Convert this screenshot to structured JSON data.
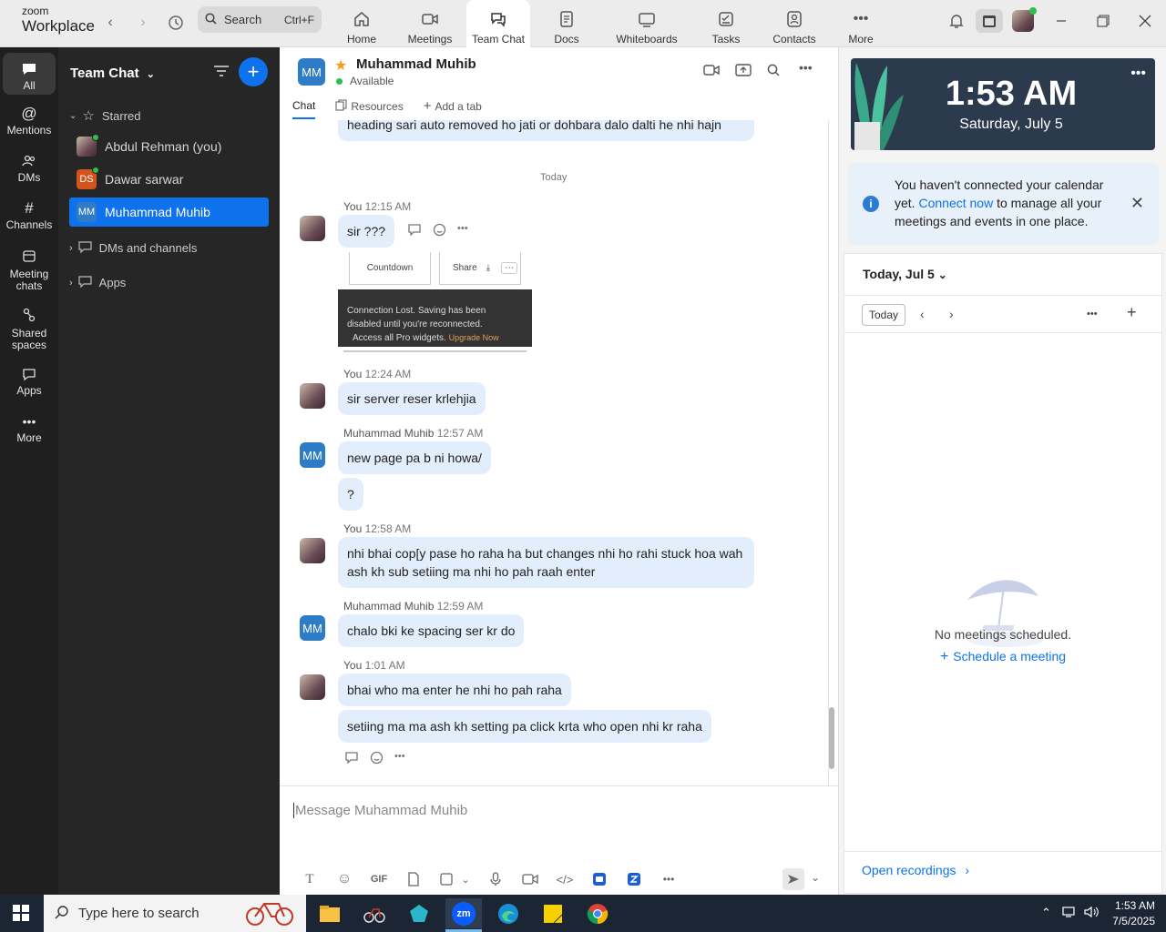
{
  "brand": {
    "line1": "zoom",
    "line2": "Workplace"
  },
  "topbar": {
    "search_placeholder": "Search",
    "search_shortcut": "Ctrl+F",
    "tabs": [
      {
        "label": "Home",
        "icon": "home-icon"
      },
      {
        "label": "Meetings",
        "icon": "video-icon"
      },
      {
        "label": "Team Chat",
        "icon": "chat-icon",
        "active": true
      },
      {
        "label": "Docs",
        "icon": "docs-icon"
      },
      {
        "label": "Whiteboards",
        "icon": "whiteboard-icon"
      },
      {
        "label": "Tasks",
        "icon": "tasks-icon"
      },
      {
        "label": "Contacts",
        "icon": "contacts-icon"
      },
      {
        "label": "More",
        "icon": "more-icon"
      }
    ]
  },
  "rail": {
    "items": [
      {
        "label": "All",
        "icon": "chat-icon",
        "active": true
      },
      {
        "label": "Mentions",
        "icon": "at-icon"
      },
      {
        "label": "DMs",
        "icon": "people-icon"
      },
      {
        "label": "Channels",
        "icon": "hash-icon"
      },
      {
        "label": "Meeting chats",
        "icon": "calendar-icon"
      },
      {
        "label": "Shared spaces",
        "icon": "shared-icon"
      },
      {
        "label": "Apps",
        "icon": "apps-icon"
      },
      {
        "label": "More",
        "icon": "more-icon"
      }
    ]
  },
  "sidebar": {
    "title": "Team Chat",
    "starred_label": "Starred",
    "contacts": [
      {
        "name": "Abdul Rehman (you)",
        "initials": "",
        "color": "#7a5560",
        "online": true
      },
      {
        "name": "Dawar sarwar",
        "initials": "DS",
        "color": "#d2531b",
        "online": true
      },
      {
        "name": "Muhammad Muhib",
        "initials": "MM",
        "color": "#2e7bc6",
        "selected": true
      }
    ],
    "sections": [
      "DMs and channels",
      "Apps"
    ]
  },
  "chat": {
    "contact_name": "Muhammad Muhib",
    "contact_initials": "MM",
    "status": "Available",
    "tabs": [
      "Chat",
      "Resources",
      "Add a tab"
    ],
    "day_separator": "Today",
    "top_partial_text": "heading sari auto removed ho jati or dohbara dalo dalti he nhi hajn",
    "snapshot": {
      "card1": "Countdown",
      "card2": "Share",
      "dark_line1": "Connection Lost. Saving has been",
      "dark_line2": "disabled until you're reconnected.",
      "dark_line3": "Access all Pro widgets.",
      "upgrade": "Upgrade Now"
    },
    "messages": [
      {
        "sender": "You",
        "time": "12:15 AM",
        "text": "sir ???"
      },
      {
        "sender": "You",
        "time": "12:24 AM",
        "text": "sir server reser krlehjia"
      },
      {
        "sender": "Muhammad Muhib",
        "time": "12:57 AM",
        "text": "new page pa b ni howa/",
        "text2": "?"
      },
      {
        "sender": "You",
        "time": "12:58 AM",
        "text": "nhi bhai cop[y pase ho raha ha but changes nhi ho rahi stuck hoa wah ash kh sub setiing ma nhi ho pah raah enter"
      },
      {
        "sender": "Muhammad Muhib",
        "time": "12:59 AM",
        "text": "chalo bki ke spacing ser kr do"
      },
      {
        "sender": "You",
        "time": "1:01 AM",
        "text": "bhai who ma enter he nhi ho pah raha",
        "text2": "setiing ma ma ash kh setting pa click krta who open nhi kr raha"
      }
    ],
    "composer_placeholder": "Message Muhammad Muhib",
    "composer_tools": [
      "T",
      "☺",
      "GIF"
    ]
  },
  "calendar": {
    "time": "1:53 AM",
    "date": "Saturday, July 5",
    "notice_pre": "You haven't connected your calendar yet.",
    "notice_link": "Connect now",
    "notice_post": "to manage all your meetings and events in one place.",
    "current_day": "Today, Jul 5",
    "today_button": "Today",
    "empty_text": "No meetings scheduled.",
    "schedule_link": "Schedule a meeting",
    "recordings_link": "Open recordings"
  },
  "taskbar": {
    "search_placeholder": "Type here to search",
    "time": "1:53 AM",
    "date": "7/5/2025"
  }
}
